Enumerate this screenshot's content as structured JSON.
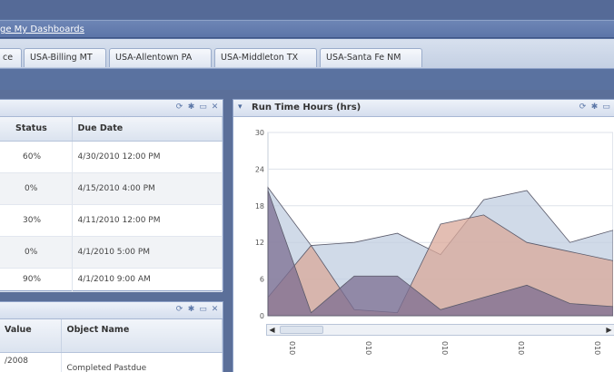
{
  "header": {
    "link_text": "ge My Dashboards"
  },
  "tabs": [
    "ce",
    "USA-Billing MT",
    "USA-Allentown PA",
    "USA-Middleton TX",
    "USA-Santa Fe NM"
  ],
  "tasks_panel": {
    "columns": [
      "Status",
      "Due Date"
    ],
    "rows": [
      {
        "status": "60%",
        "due": "4/30/2010 12:00 PM"
      },
      {
        "status": "0%",
        "due": "4/15/2010 4:00 PM"
      },
      {
        "status": "30%",
        "due": "4/11/2010 12:00 PM"
      },
      {
        "status": "0%",
        "due": "4/1/2010 5:00 PM"
      },
      {
        "status": "90%",
        "due": "4/1/2010 9:00 AM"
      }
    ]
  },
  "objects_panel": {
    "columns": [
      "Value",
      "Object Name"
    ],
    "rows": [
      {
        "value": "/2008",
        "name": "Completed Pastdue"
      }
    ]
  },
  "runtime_panel": {
    "title": "Run Time Hours (hrs)"
  },
  "chart_data": {
    "type": "area",
    "title": "Run Time Hours (hrs)",
    "ylim": [
      0,
      30
    ],
    "yticks": [
      0,
      6,
      12,
      18,
      24,
      30
    ],
    "x_tick_labels": [
      "010",
      "010",
      "010",
      "010",
      "010"
    ],
    "x": [
      0,
      1,
      2,
      3,
      4,
      5,
      6,
      7,
      8
    ],
    "series": [
      {
        "values": [
          21,
          11.5,
          12,
          13.5,
          10,
          19,
          20.5,
          12,
          14
        ],
        "color": "#c0cde0"
      },
      {
        "values": [
          3,
          11.5,
          1,
          0.5,
          15,
          16.5,
          12,
          10.5,
          9
        ],
        "color": "#d9a899"
      },
      {
        "values": [
          20.5,
          0.5,
          6.5,
          6.5,
          1,
          3,
          5,
          2,
          1.5
        ],
        "color": "#7c6e91"
      }
    ],
    "colors": {
      "grid": "#dde2ea",
      "axis": "#555555"
    }
  }
}
